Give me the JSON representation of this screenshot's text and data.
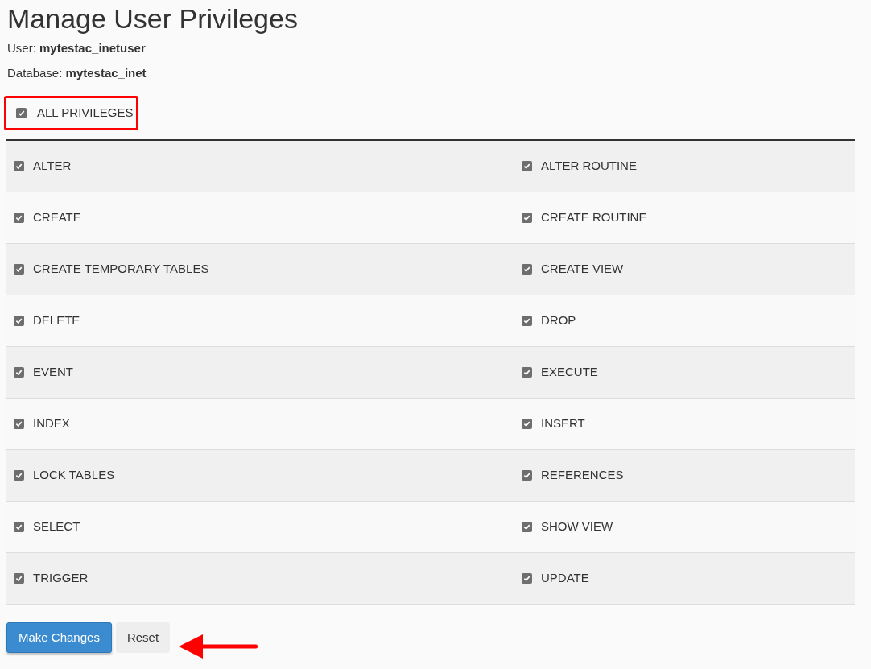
{
  "title": "Manage User Privileges",
  "details": [
    "User: **mytestac_inetuser**",
    "Database: **mytestac_inet**"
  ],
  "all_privileges": {
    "label": "ALL PRIVILEGES",
    "checked": true,
    "highlighted": true
  },
  "privileges": [
    {
      "label": "ALTER",
      "checked": true
    },
    {
      "label": "ALTER ROUTINE",
      "checked": true
    },
    {
      "label": "CREATE",
      "checked": true
    },
    {
      "label": "CREATE ROUTINE",
      "checked": true
    },
    {
      "label": "CREATE TEMPORARY TABLES",
      "checked": true
    },
    {
      "label": "CREATE VIEW",
      "checked": true
    },
    {
      "label": "DELETE",
      "checked": true
    },
    {
      "label": "DROP",
      "checked": true
    },
    {
      "label": "EVENT",
      "checked": true
    },
    {
      "label": "EXECUTE",
      "checked": true
    },
    {
      "label": "INDEX",
      "checked": true
    },
    {
      "label": "INSERT",
      "checked": true
    },
    {
      "label": "LOCK TABLES",
      "checked": true
    },
    {
      "label": "REFERENCES",
      "checked": true
    },
    {
      "label": "SELECT",
      "checked": true
    },
    {
      "label": "SHOW VIEW",
      "checked": true
    },
    {
      "label": "TRIGGER",
      "checked": true
    },
    {
      "label": "UPDATE",
      "checked": true
    }
  ],
  "buttons": [
    {
      "label": "Make Changes",
      "kind": "primary"
    },
    {
      "label": "Reset",
      "kind": "secondary"
    }
  ]
}
